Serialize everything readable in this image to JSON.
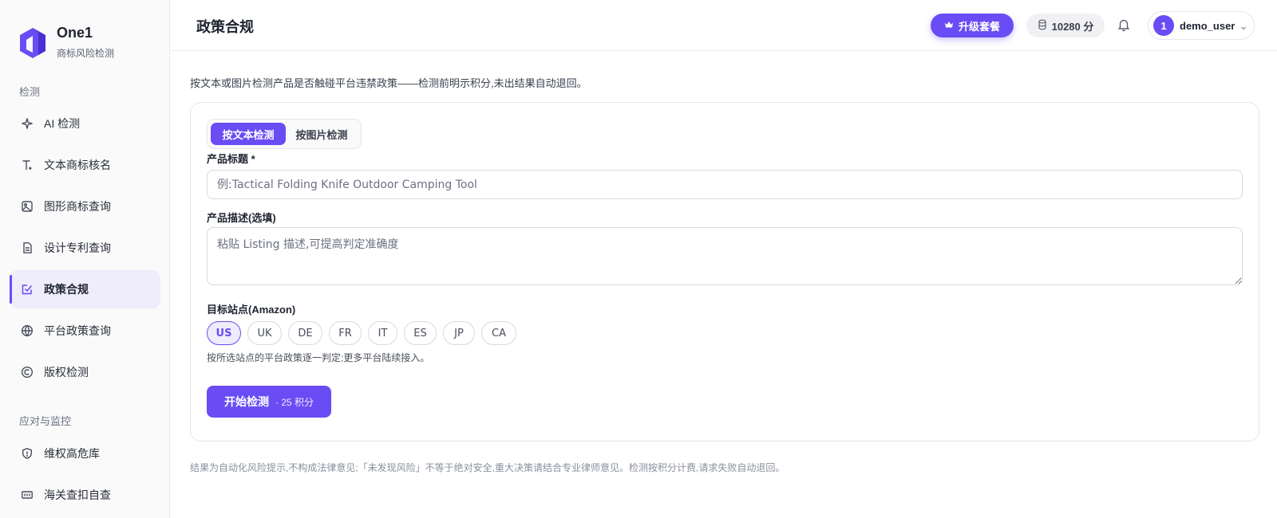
{
  "brand": {
    "name": "One1",
    "subtitle": "商标风险检测"
  },
  "sidebar": {
    "section_detect": "检测",
    "section_monitor": "应对与监控",
    "items": [
      {
        "label": "AI 检测",
        "icon": "sparkle-icon"
      },
      {
        "label": "文本商标核名",
        "icon": "text-icon"
      },
      {
        "label": "图形商标查询",
        "icon": "image-icon"
      },
      {
        "label": "设计专利查询",
        "icon": "document-icon"
      },
      {
        "label": "政策合规",
        "icon": "checklist-icon",
        "active": true
      },
      {
        "label": "平台政策查询",
        "icon": "globe-icon"
      },
      {
        "label": "版权检测",
        "icon": "copyright-icon"
      },
      {
        "label": "维权高危库",
        "icon": "shield-icon"
      },
      {
        "label": "海关查扣自查",
        "icon": "customs-icon"
      }
    ]
  },
  "header": {
    "title": "政策合规",
    "upgrade_label": "升级套餐",
    "credits": "10280 分",
    "user_initial": "1",
    "username": "demo_user"
  },
  "main": {
    "intro": "按文本或图片检测产品是否触碰平台违禁政策——检测前明示积分,未出结果自动退回。",
    "tabs": [
      "按文本检测",
      "按图片检测"
    ],
    "title_label": "产品标题 *",
    "title_placeholder": "例:Tactical Folding Knife Outdoor Camping Tool",
    "desc_label": "产品描述(选填)",
    "desc_placeholder": "粘贴 Listing 描述,可提高判定准确度",
    "sites_label": "目标站点(Amazon)",
    "sites": [
      "US",
      "UK",
      "DE",
      "FR",
      "IT",
      "ES",
      "JP",
      "CA"
    ],
    "selected_site": "US",
    "sites_hint": "按所选站点的平台政策逐一判定;更多平台陆续接入。",
    "start_label": "开始检测",
    "start_cost": "· 25 积分",
    "disclaimer": "结果为自动化风险提示,不构成法律意见;「未发现风险」不等于绝对安全,重大决策请结合专业律师意见。检测按积分计费,请求失败自动退回。"
  },
  "colors": {
    "accent": "#6a4cf5",
    "accent_soft": "#efecfc"
  }
}
